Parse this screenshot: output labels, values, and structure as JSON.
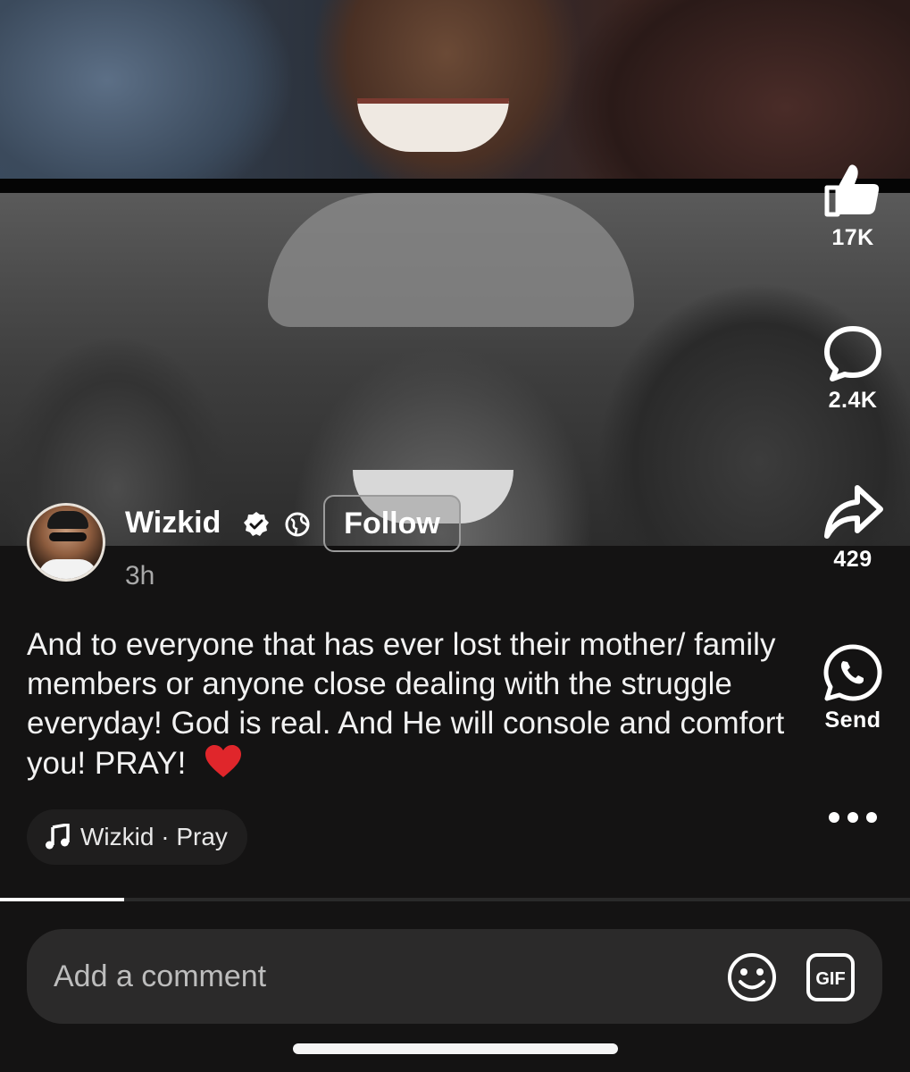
{
  "post": {
    "author": "Wizkid",
    "time": "3h",
    "follow_label": "Follow",
    "caption": "And to everyone that has ever lost their mother/ family members or anyone close dealing with the struggle everyday! God is real. And He  will console and comfort you! PRAY!"
  },
  "actions": {
    "likes": "17K",
    "comments": "2.4K",
    "shares": "429",
    "send_label": "Send"
  },
  "music": {
    "label": "Wizkid · Pray"
  },
  "progress": {
    "fraction": 0.136
  },
  "comment": {
    "placeholder": "Add a comment"
  },
  "icons": [
    "like-icon",
    "comment-icon",
    "share-icon",
    "whatsapp-icon",
    "more-icon",
    "music-note-icon",
    "emoji-icon",
    "gif-icon",
    "verified-icon",
    "globe-icon",
    "heart-icon"
  ],
  "colors": {
    "background": "#141313",
    "pill": "#1f1e1e",
    "comment_bar": "#2b2a2a",
    "heart": "#e0262b"
  }
}
